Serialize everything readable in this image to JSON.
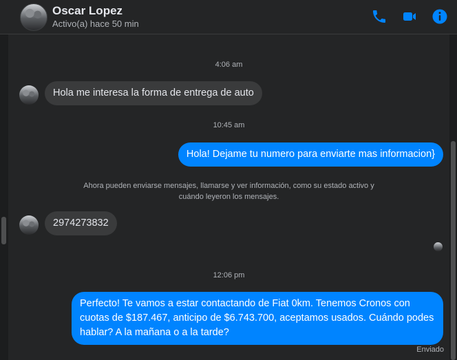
{
  "header": {
    "name": "Oscar Lopez",
    "status": "Activo(a) hace 50 min",
    "accent_color": "#0084ff",
    "icons": [
      "phone-icon",
      "video-camera-icon",
      "info-icon"
    ]
  },
  "messages": [
    {
      "type": "timestamp",
      "text": "4:06 am"
    },
    {
      "type": "incoming",
      "text": "Hola me interesa la forma de entrega de auto"
    },
    {
      "type": "timestamp",
      "text": "10:45 am"
    },
    {
      "type": "outgoing",
      "text": "Hola! Dejame tu numero para enviarte mas informacion}"
    },
    {
      "type": "notice",
      "text": "Ahora pueden enviarse mensajes, llamarse y ver información, como su estado activo y cuándo leyeron los mensajes."
    },
    {
      "type": "incoming",
      "text": "2974273832"
    },
    {
      "type": "timestamp",
      "text": "12:06 pm"
    },
    {
      "type": "outgoing",
      "text": "Perfecto! Te vamos a estar contactando de Fiat 0km. Tenemos Cronos con cuotas de $187.467, anticipo de $6.743.700, aceptamos usados. Cuándo podes hablar? A la mañana o a la tarde?"
    }
  ],
  "delivery_status": "Enviado"
}
